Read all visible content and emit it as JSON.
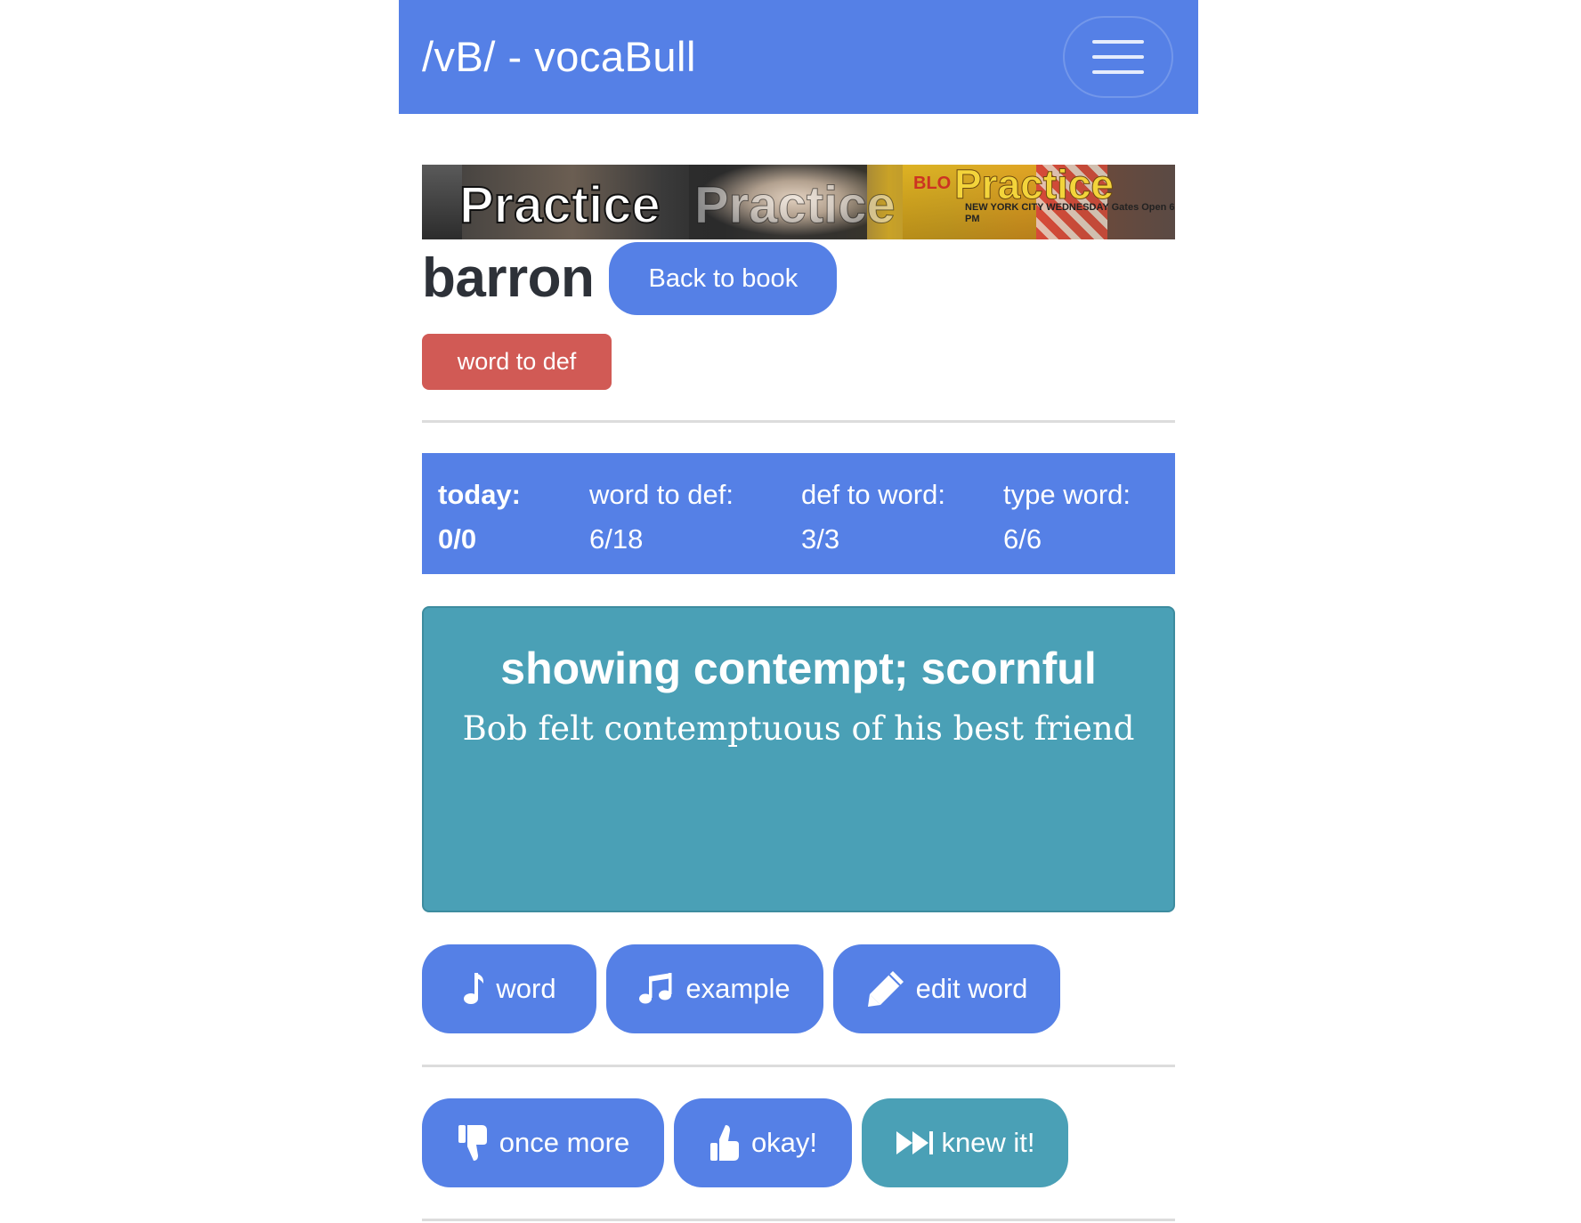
{
  "navbar": {
    "brand": "/vB/ - vocaBull",
    "menu_icon": "hamburger-menu-icon"
  },
  "banner": {
    "alt": "Practice banner",
    "words": [
      "Practice",
      "Practice",
      "Practice"
    ],
    "small_text_1": "BLO",
    "small_text_2": "NEW YORK CITY WEDNESDAY Gates Open 6 PM"
  },
  "word": {
    "title": "barron",
    "back_label": "Back to book",
    "mode_label": "word to def"
  },
  "stats": {
    "today_label": "today:",
    "today_value": "0/0",
    "word_to_def_label": "word to def:",
    "word_to_def_value": "6/18",
    "def_to_word_label": "def to word:",
    "def_to_word_value": "3/3",
    "type_word_label": "type word:",
    "type_word_value": "6/6"
  },
  "card": {
    "definition": "showing contempt; scornful",
    "example": "Bob felt contemptuous of his best friend"
  },
  "actions": {
    "word_audio_label": "word",
    "word_audio_icon": "music-note-icon",
    "example_audio_label": "example",
    "example_audio_icon": "music-notes-icon",
    "edit_label": "edit word",
    "edit_icon": "pencil-icon"
  },
  "grading": {
    "once_more_label": "once more",
    "once_more_icon": "thumbs-down-icon",
    "okay_label": "okay!",
    "okay_icon": "thumbs-up-icon",
    "knew_label": "knew it!",
    "knew_icon": "fast-forward-icon"
  },
  "colors": {
    "primary": "#5580e6",
    "teal": "#4aa0b6",
    "danger": "#d15a55",
    "title_text": "#2d3138"
  }
}
